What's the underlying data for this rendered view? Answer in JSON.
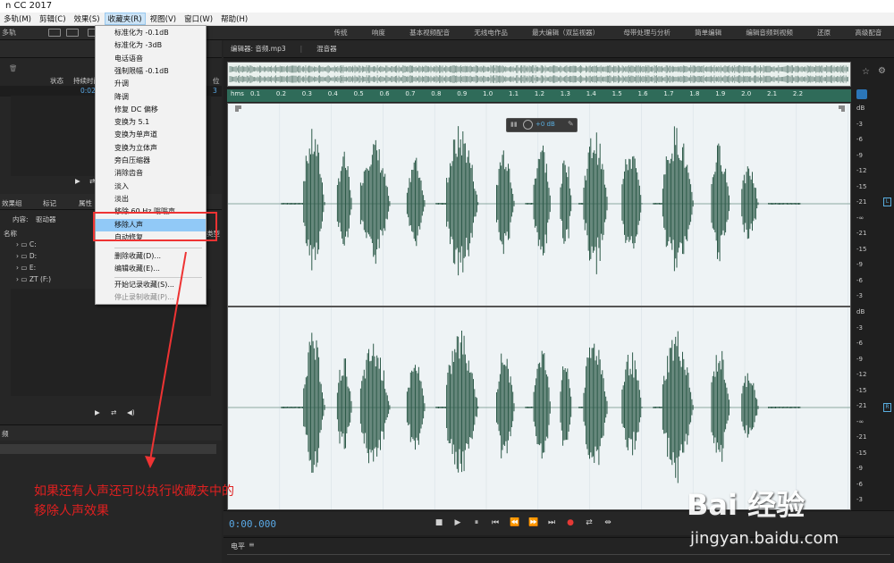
{
  "title_bar": {
    "text": "n CC 2017"
  },
  "menu": [
    {
      "label": "多轨(M)"
    },
    {
      "label": "剪辑(C)"
    },
    {
      "label": "效果(S)"
    },
    {
      "label": "收藏夹(R)"
    },
    {
      "label": "视图(V)"
    },
    {
      "label": "窗口(W)"
    },
    {
      "label": "帮助(H)"
    }
  ],
  "toolbar": {
    "multitrack_label": "多轨"
  },
  "workspaces": [
    "传统",
    "响度",
    "基本视频配音",
    "无线电作品",
    "最大编辑（双监视器）",
    "母带处理与分析",
    "简单编辑",
    "编辑音频到视频",
    "还原",
    "高级配音"
  ],
  "left_panel": {
    "files_columns": {
      "status": "状态",
      "duration": "持续时间",
      "time_value": "0:02.3",
      "extra": "3",
      "col_letter": "位"
    },
    "tabs": [
      "效果组",
      "标记",
      "属性"
    ],
    "content_label": "内容:",
    "content_value": "驱动器",
    "name_header": "名称",
    "type_header": "类型",
    "drives": [
      "C:",
      "D:",
      "E:",
      "ZT (F:)"
    ],
    "bottom_label": "频"
  },
  "favorites_menu": {
    "items": [
      {
        "label": "标准化为 -0.1dB"
      },
      {
        "label": "标准化为 -3dB"
      },
      {
        "label": "电话语音"
      },
      {
        "label": "强制限幅 -0.1dB"
      },
      {
        "label": "升调"
      },
      {
        "label": "降调"
      },
      {
        "label": "修复 DC 偏移"
      },
      {
        "label": "变换为 5.1"
      },
      {
        "label": "变换为单声道"
      },
      {
        "label": "变换为立体声"
      },
      {
        "label": "旁白压缩器"
      },
      {
        "label": "消除齿音"
      },
      {
        "label": "淡入"
      },
      {
        "label": "淡出"
      },
      {
        "label": "移除 60 Hz 嗡嗡声"
      },
      {
        "label": "移除人声",
        "highlighted": true
      },
      {
        "label": "自动修复"
      }
    ],
    "commands": [
      {
        "label": "删除收藏(D)..."
      },
      {
        "label": "编辑收藏(E)..."
      },
      {
        "label": "开始记录收藏(S)..."
      },
      {
        "label": "停止录制收藏(P)...",
        "disabled": true
      }
    ]
  },
  "editor": {
    "tab_label": "编辑器: 音频.mp3",
    "mixer_label": "混音器",
    "ruler_unit": "hms",
    "ruler_ticks": [
      "0.1",
      "0.2",
      "0.3",
      "0.4",
      "0.5",
      "0.6",
      "0.7",
      "0.8",
      "0.9",
      "1.0",
      "1.1",
      "1.2",
      "1.3",
      "1.4",
      "1.5",
      "1.6",
      "1.7",
      "1.8",
      "1.9",
      "2.0",
      "2.1",
      "2.2"
    ],
    "hud_value": "+0 dB",
    "db_scale_top": [
      "dB",
      "-3",
      "-6",
      "-9",
      "-12",
      "-15",
      "-21",
      "-∞",
      "-21",
      "-15",
      "-9",
      "-6",
      "-3"
    ],
    "db_scale_bottom": [
      "dB",
      "-3",
      "-6",
      "-9",
      "-12",
      "-15",
      "-21",
      "-∞",
      "-21",
      "-15",
      "-9",
      "-6",
      "-3"
    ],
    "channel_left": "L",
    "channel_right": "R",
    "timecode": "0:00.000",
    "levels_label": "电平"
  },
  "annotation": {
    "line1": "如果还有人声还可以执行收藏夹中的",
    "line2": "移除人声效果"
  },
  "watermark": {
    "main": "Bai 经验",
    "sub": "jingyan.baidu.com"
  },
  "colors": {
    "wave": "#2d5a49",
    "ruler": "#2f6b59",
    "timecode": "#5aa9e6",
    "highlight": "#91c9f7",
    "annotation": "#e02020"
  }
}
